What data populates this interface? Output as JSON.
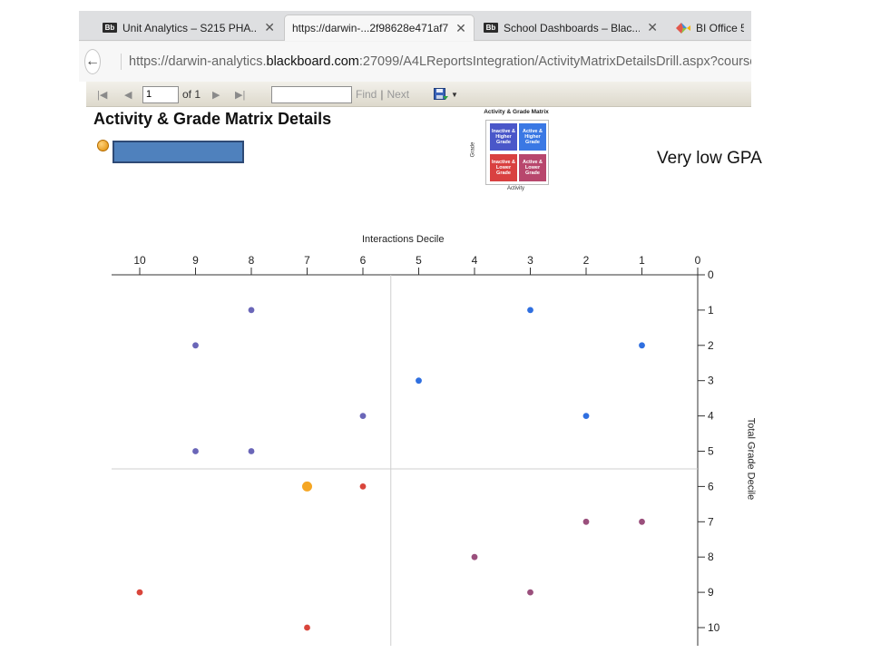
{
  "browser": {
    "tabs": [
      {
        "label": "Unit Analytics – S215 PHA...",
        "favicon": "bb-icon"
      },
      {
        "label": "https://darwin-...2f98628e471af7",
        "favicon": "none"
      },
      {
        "label": "School Dashboards – Blac...",
        "favicon": "bb-icon"
      },
      {
        "label": "BI Office 5",
        "favicon": "bi-office-icon"
      }
    ],
    "active_tab_index": 1,
    "url_prefix": "https://darwin-analytics.",
    "url_host": "blackboard.com",
    "url_suffix": ":27099/A4LReportsIntegration/ActivityMatrixDetailsDrill.aspx?coursePk"
  },
  "report_toolbar": {
    "page_value": "1",
    "of_label": "of 1",
    "find_value": "",
    "find_label": "Find",
    "separator": "|",
    "next_label": "Next"
  },
  "report": {
    "title": "Activity & Grade Matrix Details",
    "annotation": "Very low GPA",
    "colors": {
      "blue": "#2f6fe0",
      "purple": "#6a66b8",
      "red": "#d9453b",
      "mauve": "#9a4f7c",
      "orange": "#f5a623",
      "box_blue": "#4f81bd"
    }
  },
  "legend": {
    "title": "Activity & Grade Matrix",
    "y_label": "Grade",
    "x_label": "Activity",
    "cells": [
      {
        "label": "Inactive & Higher Grade",
        "color": "#4a57c9"
      },
      {
        "label": "Active & Higher Grade",
        "color": "#3a78e4"
      },
      {
        "label": "Inactive & Lower Grade",
        "color": "#d94040"
      },
      {
        "label": "Active & Lower Grade",
        "color": "#b8476d"
      }
    ]
  },
  "chart_data": {
    "type": "scatter",
    "xlabel": "Interactions Decile",
    "ylabel": "Total Grade Decile",
    "x_ticks": [
      10,
      9,
      8,
      7,
      6,
      5,
      4,
      3,
      2,
      1,
      0
    ],
    "y_ticks": [
      0,
      1,
      2,
      3,
      4,
      5,
      6,
      7,
      8,
      9,
      10
    ],
    "xlim": [
      10.2,
      0
    ],
    "ylim": [
      0,
      10
    ],
    "x_axis_position": "top",
    "y_axis_position": "right",
    "reference_lines": {
      "x": 5.5,
      "y": 5.5
    },
    "points": [
      {
        "x": 8,
        "y": 1,
        "color": "#6a66b8"
      },
      {
        "x": 3,
        "y": 1,
        "color": "#2f6fe0"
      },
      {
        "x": 9,
        "y": 2,
        "color": "#6a66b8"
      },
      {
        "x": 1,
        "y": 2,
        "color": "#2f6fe0"
      },
      {
        "x": 5,
        "y": 3,
        "color": "#2f6fe0"
      },
      {
        "x": 6,
        "y": 4,
        "color": "#6a66b8"
      },
      {
        "x": 2,
        "y": 4,
        "color": "#2f6fe0"
      },
      {
        "x": 9,
        "y": 5,
        "color": "#6a66b8"
      },
      {
        "x": 8,
        "y": 5,
        "color": "#6a66b8"
      },
      {
        "x": 7,
        "y": 6,
        "color": "#f5a623",
        "highlight": true
      },
      {
        "x": 6,
        "y": 6,
        "color": "#d9453b"
      },
      {
        "x": 2,
        "y": 7,
        "color": "#9a4f7c"
      },
      {
        "x": 1,
        "y": 7,
        "color": "#9a4f7c"
      },
      {
        "x": 4,
        "y": 8,
        "color": "#9a4f7c"
      },
      {
        "x": 10,
        "y": 9,
        "color": "#d9453b"
      },
      {
        "x": 3,
        "y": 9,
        "color": "#9a4f7c"
      },
      {
        "x": 7,
        "y": 10,
        "color": "#d9453b"
      }
    ]
  }
}
